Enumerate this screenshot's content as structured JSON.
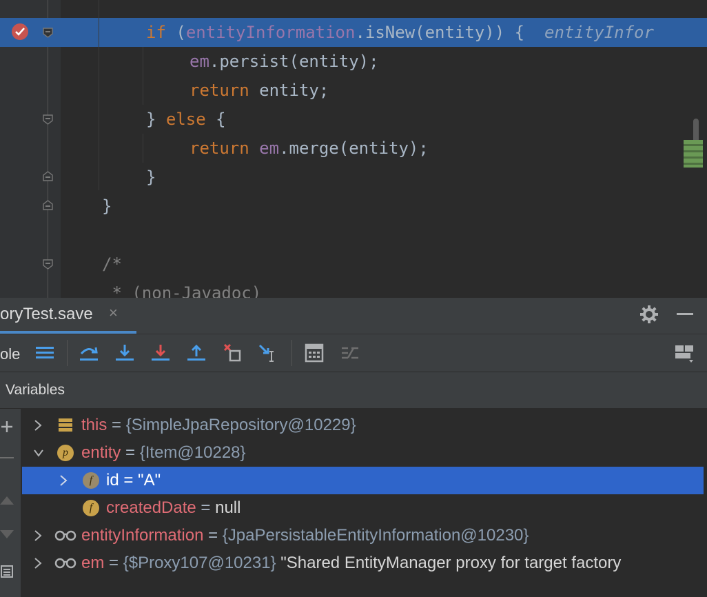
{
  "editor": {
    "line_if_kw": "if",
    "line_if_open": "(",
    "line_if_field": "entityInformation",
    "line_if_rest": ".isNew(entity)) {",
    "line_if_hint": "entityInfor",
    "line_persist_field": "em",
    "line_persist_rest": ".persist(entity);",
    "line_return_kw": "return",
    "line_return_rest": " entity;",
    "line_close_else_pre": "} ",
    "line_else_kw": "else",
    "line_else_post": " {",
    "line_return2_kw": "return",
    "line_return2_field": "em",
    "line_return2_rest": ".merge(entity);",
    "line_brace1": "}",
    "line_brace2": "}",
    "line_comment1": "/*",
    "line_comment2": " * (non-Javadoc)"
  },
  "debug": {
    "tab_label": "oryTest.save",
    "tab_close": "×",
    "toolbar_label": "ole",
    "variables_title": "Variables"
  },
  "variables": [
    {
      "name": "this",
      "eq": " = ",
      "value": "{SimpleJpaRepository@10229}",
      "icon": "field-list-icon"
    },
    {
      "name": "entity",
      "eq": " = ",
      "value": "{Item@10228}",
      "icon": "parameter-icon",
      "icon_letter": "p"
    },
    {
      "name": "id",
      "eq": " = ",
      "value": "\"A\"",
      "icon": "field-icon",
      "icon_letter": "f"
    },
    {
      "name": "createdDate",
      "eq": " = ",
      "value": "null",
      "icon": "field-icon",
      "icon_letter": "f"
    },
    {
      "name": "entityInformation",
      "eq": " = ",
      "value": "{JpaPersistableEntityInformation@10230}",
      "icon": "watch-icon"
    },
    {
      "name": "em",
      "eq": " = ",
      "value": "{$Proxy107@10231}",
      "extra": " \"Shared EntityManager proxy for target factory",
      "icon": "watch-icon"
    }
  ],
  "colors": {
    "highlight_line": "#2d5fa1",
    "selected_row": "#2f65ca",
    "keyword": "#cc7832",
    "field": "#9876aa",
    "var_name": "#e06c75"
  }
}
